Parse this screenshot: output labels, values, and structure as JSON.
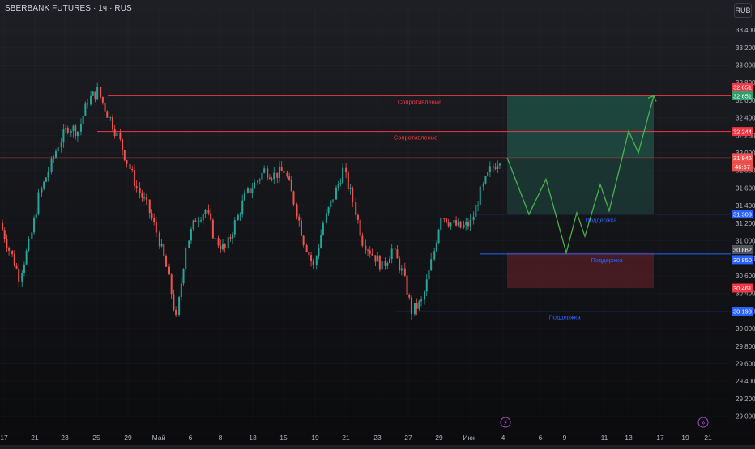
{
  "header": {
    "symbol_title": "SBERBANK FUTURES · 1ч · RUS",
    "currency": "RUB"
  },
  "colors": {
    "bull": "#26a69a",
    "bear": "#ef5350",
    "resistance": "#f23645",
    "support": "#2962ff",
    "projection": "#4caf50",
    "target_zone": "#1f4d44",
    "stop_zone": "#4b1d24"
  },
  "chart_data": {
    "type": "candlestick",
    "timeframe": "1h",
    "x_axis": {
      "tick_labels": [
        "17",
        "21",
        "23",
        "25",
        "29",
        "Май",
        "6",
        "8",
        "13",
        "15",
        "19",
        "21",
        "23",
        "27",
        "29",
        "Июн",
        "4",
        "6",
        "9",
        "11",
        "13",
        "17",
        "19",
        "21"
      ]
    },
    "y_axis": {
      "range": [
        28950,
        33650
      ],
      "tick_labels": [
        "33 400",
        "33 200",
        "33 000",
        "32 800",
        "32 600",
        "32 400",
        "32 200",
        "32 000",
        "31 800",
        "31 600",
        "31 400",
        "31 200",
        "31 000",
        "30 800",
        "30 600",
        "30 400",
        "30 200",
        "30 000",
        "29 800",
        "29 600",
        "29 400",
        "29 200",
        "29 000"
      ]
    },
    "levels": [
      {
        "name": "resistance-1",
        "label": "Сопротивление",
        "price": 32651,
        "tag": "32 651",
        "kind": "resistance"
      },
      {
        "name": "resistance-2",
        "label": "Сопротивление",
        "price": 32244,
        "tag": "32 244",
        "kind": "resistance"
      },
      {
        "name": "support-1",
        "label": "Поддержка",
        "price": 31303,
        "tag": "31 303",
        "kind": "support"
      },
      {
        "name": "support-2",
        "label": "Поддержка",
        "price": 30850,
        "tag": "30 850",
        "kind": "support"
      },
      {
        "name": "support-3",
        "label": "Поддержка",
        "price": 30198,
        "tag": "30 198",
        "kind": "support"
      }
    ],
    "current_price": {
      "price": 31946,
      "tag": "31 946",
      "countdown": "46:57"
    },
    "price_tags_extra": [
      {
        "price": 32651,
        "tag": "32 651",
        "kind": "projection"
      },
      {
        "price": 30862,
        "tag": "30 862",
        "kind": "neutral"
      },
      {
        "price": 30461,
        "tag": "30 461",
        "kind": "stop"
      }
    ],
    "position": {
      "entry": 31946,
      "target": 32651,
      "stop": 30461
    },
    "projection_path": [
      {
        "date": "Июн 4",
        "price": 31946
      },
      {
        "date": "Июн 5",
        "price": 31300
      },
      {
        "date": "Июн 6",
        "price": 31700
      },
      {
        "date": "Июн 8",
        "price": 30862
      },
      {
        "date": "Июн 8",
        "price": 31320
      },
      {
        "date": "Июн 9",
        "price": 31050
      },
      {
        "date": "Июн 10",
        "price": 31640
      },
      {
        "date": "Июн 11",
        "price": 31340
      },
      {
        "date": "Июн 12",
        "price": 32250
      },
      {
        "date": "Июн 13",
        "price": 32000
      },
      {
        "date": "Июн 14",
        "price": 32651
      }
    ],
    "series": [
      {
        "name": "",
        "anchors": [
          [
            17,
            31200
          ],
          [
            18,
            30900
          ],
          [
            19,
            30600
          ],
          [
            20,
            30950
          ],
          [
            21,
            31500
          ],
          [
            22,
            31800
          ],
          [
            23,
            32100
          ],
          [
            24,
            32300
          ],
          [
            25,
            32250
          ],
          [
            26,
            32600
          ],
          [
            27,
            32700
          ],
          [
            28,
            32450
          ],
          [
            29,
            32200
          ],
          [
            30,
            31900
          ],
          [
            31,
            31600
          ],
          [
            32,
            31400
          ],
          [
            33,
            31100
          ],
          [
            34,
            30700
          ],
          [
            35,
            30100
          ],
          [
            36,
            30950
          ],
          [
            37,
            31250
          ],
          [
            38,
            31350
          ],
          [
            39,
            31000
          ],
          [
            40,
            30900
          ],
          [
            41,
            31200
          ],
          [
            42,
            31500
          ],
          [
            43,
            31650
          ],
          [
            44,
            31800
          ],
          [
            45,
            31750
          ],
          [
            46,
            31800
          ],
          [
            47,
            31450
          ],
          [
            48,
            31000
          ],
          [
            49,
            30700
          ],
          [
            50,
            31200
          ],
          [
            51,
            31500
          ],
          [
            52,
            31800
          ],
          [
            53,
            31450
          ],
          [
            54,
            31000
          ],
          [
            55,
            30850
          ],
          [
            56,
            30700
          ],
          [
            57,
            30900
          ],
          [
            58,
            30650
          ],
          [
            59,
            30200
          ],
          [
            60,
            30300
          ],
          [
            61,
            30750
          ],
          [
            62,
            31300
          ],
          [
            63,
            31200
          ],
          [
            64,
            31150
          ],
          [
            65,
            31200
          ],
          [
            66,
            31550
          ],
          [
            67,
            31800
          ],
          [
            68,
            31946
          ]
        ]
      }
    ]
  },
  "bottom_icons": [
    {
      "name": "lightning-icon",
      "glyph": "⚡",
      "date_label": "Июн 4"
    },
    {
      "name": "fast-forward-icon",
      "glyph": "»",
      "date_label": "19"
    }
  ]
}
